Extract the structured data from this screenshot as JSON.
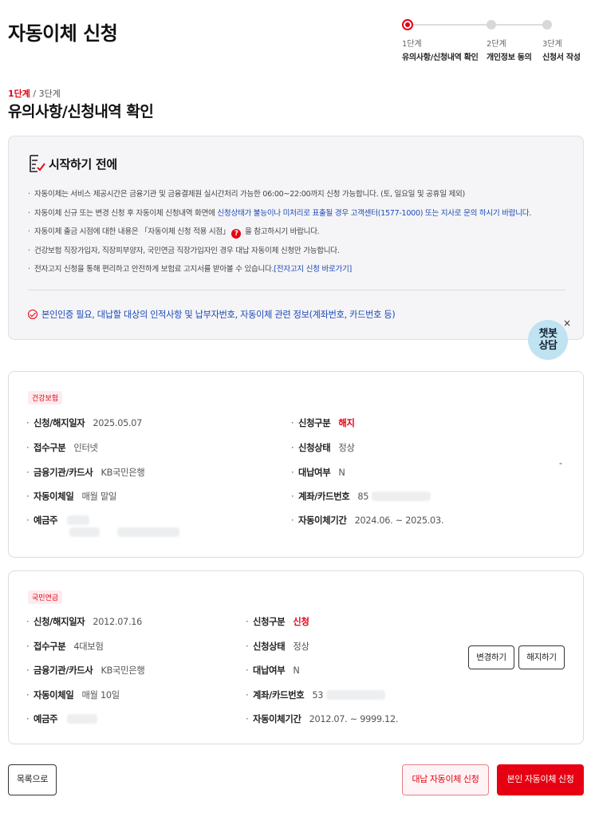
{
  "page_title": "자동이체 신청",
  "stepper": {
    "steps": [
      {
        "num": "1단계",
        "label": "유의사항/신청내역 확인"
      },
      {
        "num": "2단계",
        "label": "개인정보 동의"
      },
      {
        "num": "3단계",
        "label": "신청서 작성"
      }
    ],
    "active_index": 0
  },
  "step_indicator": {
    "current": "1단계",
    "total": " / 3단계"
  },
  "section_title": "유의사항/신청내역 확인",
  "notice": {
    "title": "시작하기 전에",
    "items": {
      "i1": "자동이체는 서비스 제공시간은 금융기관 및 금융결제원 실시간처리 가능한 06:00~22:00까지 신청 가능합니다. (토, 일요일 및 공휴일 제외)",
      "i2_pre": "자동이체 신규 또는 변경 신청 후 자동이체 신청내역 화면에 ",
      "i2_blue": "신청상태가 불능이나 미처리로 표출될 경우 고객센터(1577-1000) 또는 지사로 문의 하시기 바랍니다.",
      "i3_pre": "자동이체 출금 시점에 대한 내용은 「자동이체 신청 적용 시점」",
      "i3_post": " 을 참고하시기 바랍니다.",
      "i4": "건강보험 직장가입자, 직장피부양자, 국민연금 직장가입자인 경우 대납 자동이체 신청만 가능합니다.",
      "i5_pre": "전자고지 신청을 통해 편리하고 안전하게 보험료 고지서를 받아볼 수 있습니다.",
      "i5_link": "[전자고지 신청 바로가기]"
    },
    "check_text": "본인인증 필요, 대납할 대상의 인적사항 및 납부자번호, 자동이체 관련 정보(계좌번호, 카드번호 등)"
  },
  "chatbot": {
    "line1": "챗봇",
    "line2": "상담",
    "close": "×"
  },
  "cards": [
    {
      "badge": "건강보험",
      "fields": {
        "apply_date": {
          "label": "신청/해지일자",
          "value": "2025.05.07"
        },
        "apply_type": {
          "label": "신청구분",
          "value": "해지"
        },
        "receipt": {
          "label": "접수구분",
          "value": "인터넷"
        },
        "status": {
          "label": "신청상태",
          "value": "정상"
        },
        "bank": {
          "label": "금융기관/카드사",
          "value": "KB국민은행"
        },
        "proxy": {
          "label": "대납여부",
          "value": "N"
        },
        "transfer_day": {
          "label": "자동이체일",
          "value": "매월 말일"
        },
        "account": {
          "label": "계좌/카드번호",
          "value": "85"
        },
        "holder": {
          "label": "예금주",
          "value": ""
        },
        "period": {
          "label": "자동이체기간",
          "value": "2024.06. ~ 2025.03."
        }
      },
      "dash": "-"
    },
    {
      "badge": "국민연금",
      "fields": {
        "apply_date": {
          "label": "신청/해지일자",
          "value": "2012.07.16"
        },
        "apply_type": {
          "label": "신청구분",
          "value": "신청"
        },
        "receipt": {
          "label": "접수구분",
          "value": "4대보험"
        },
        "status": {
          "label": "신청상태",
          "value": "정상"
        },
        "bank": {
          "label": "금융기관/카드사",
          "value": "KB국민은행"
        },
        "proxy": {
          "label": "대납여부",
          "value": "N"
        },
        "transfer_day": {
          "label": "자동이체일",
          "value": "매월 10일"
        },
        "account": {
          "label": "계좌/카드번호",
          "value": "53"
        },
        "holder": {
          "label": "예금주",
          "value": ""
        },
        "period": {
          "label": "자동이체기간",
          "value": "2012.07. ~ 9999.12."
        }
      },
      "buttons": {
        "change": "변경하기",
        "cancel": "해지하기"
      }
    }
  ],
  "bottom": {
    "list_button": "목록으로",
    "proxy_button": "대납 자동이체 신청",
    "self_button": "본인 자동이체 신청"
  },
  "colors": {
    "accent": "#e60012",
    "link": "#1d49b6",
    "chatbot_bg": "#bfe3f0"
  }
}
